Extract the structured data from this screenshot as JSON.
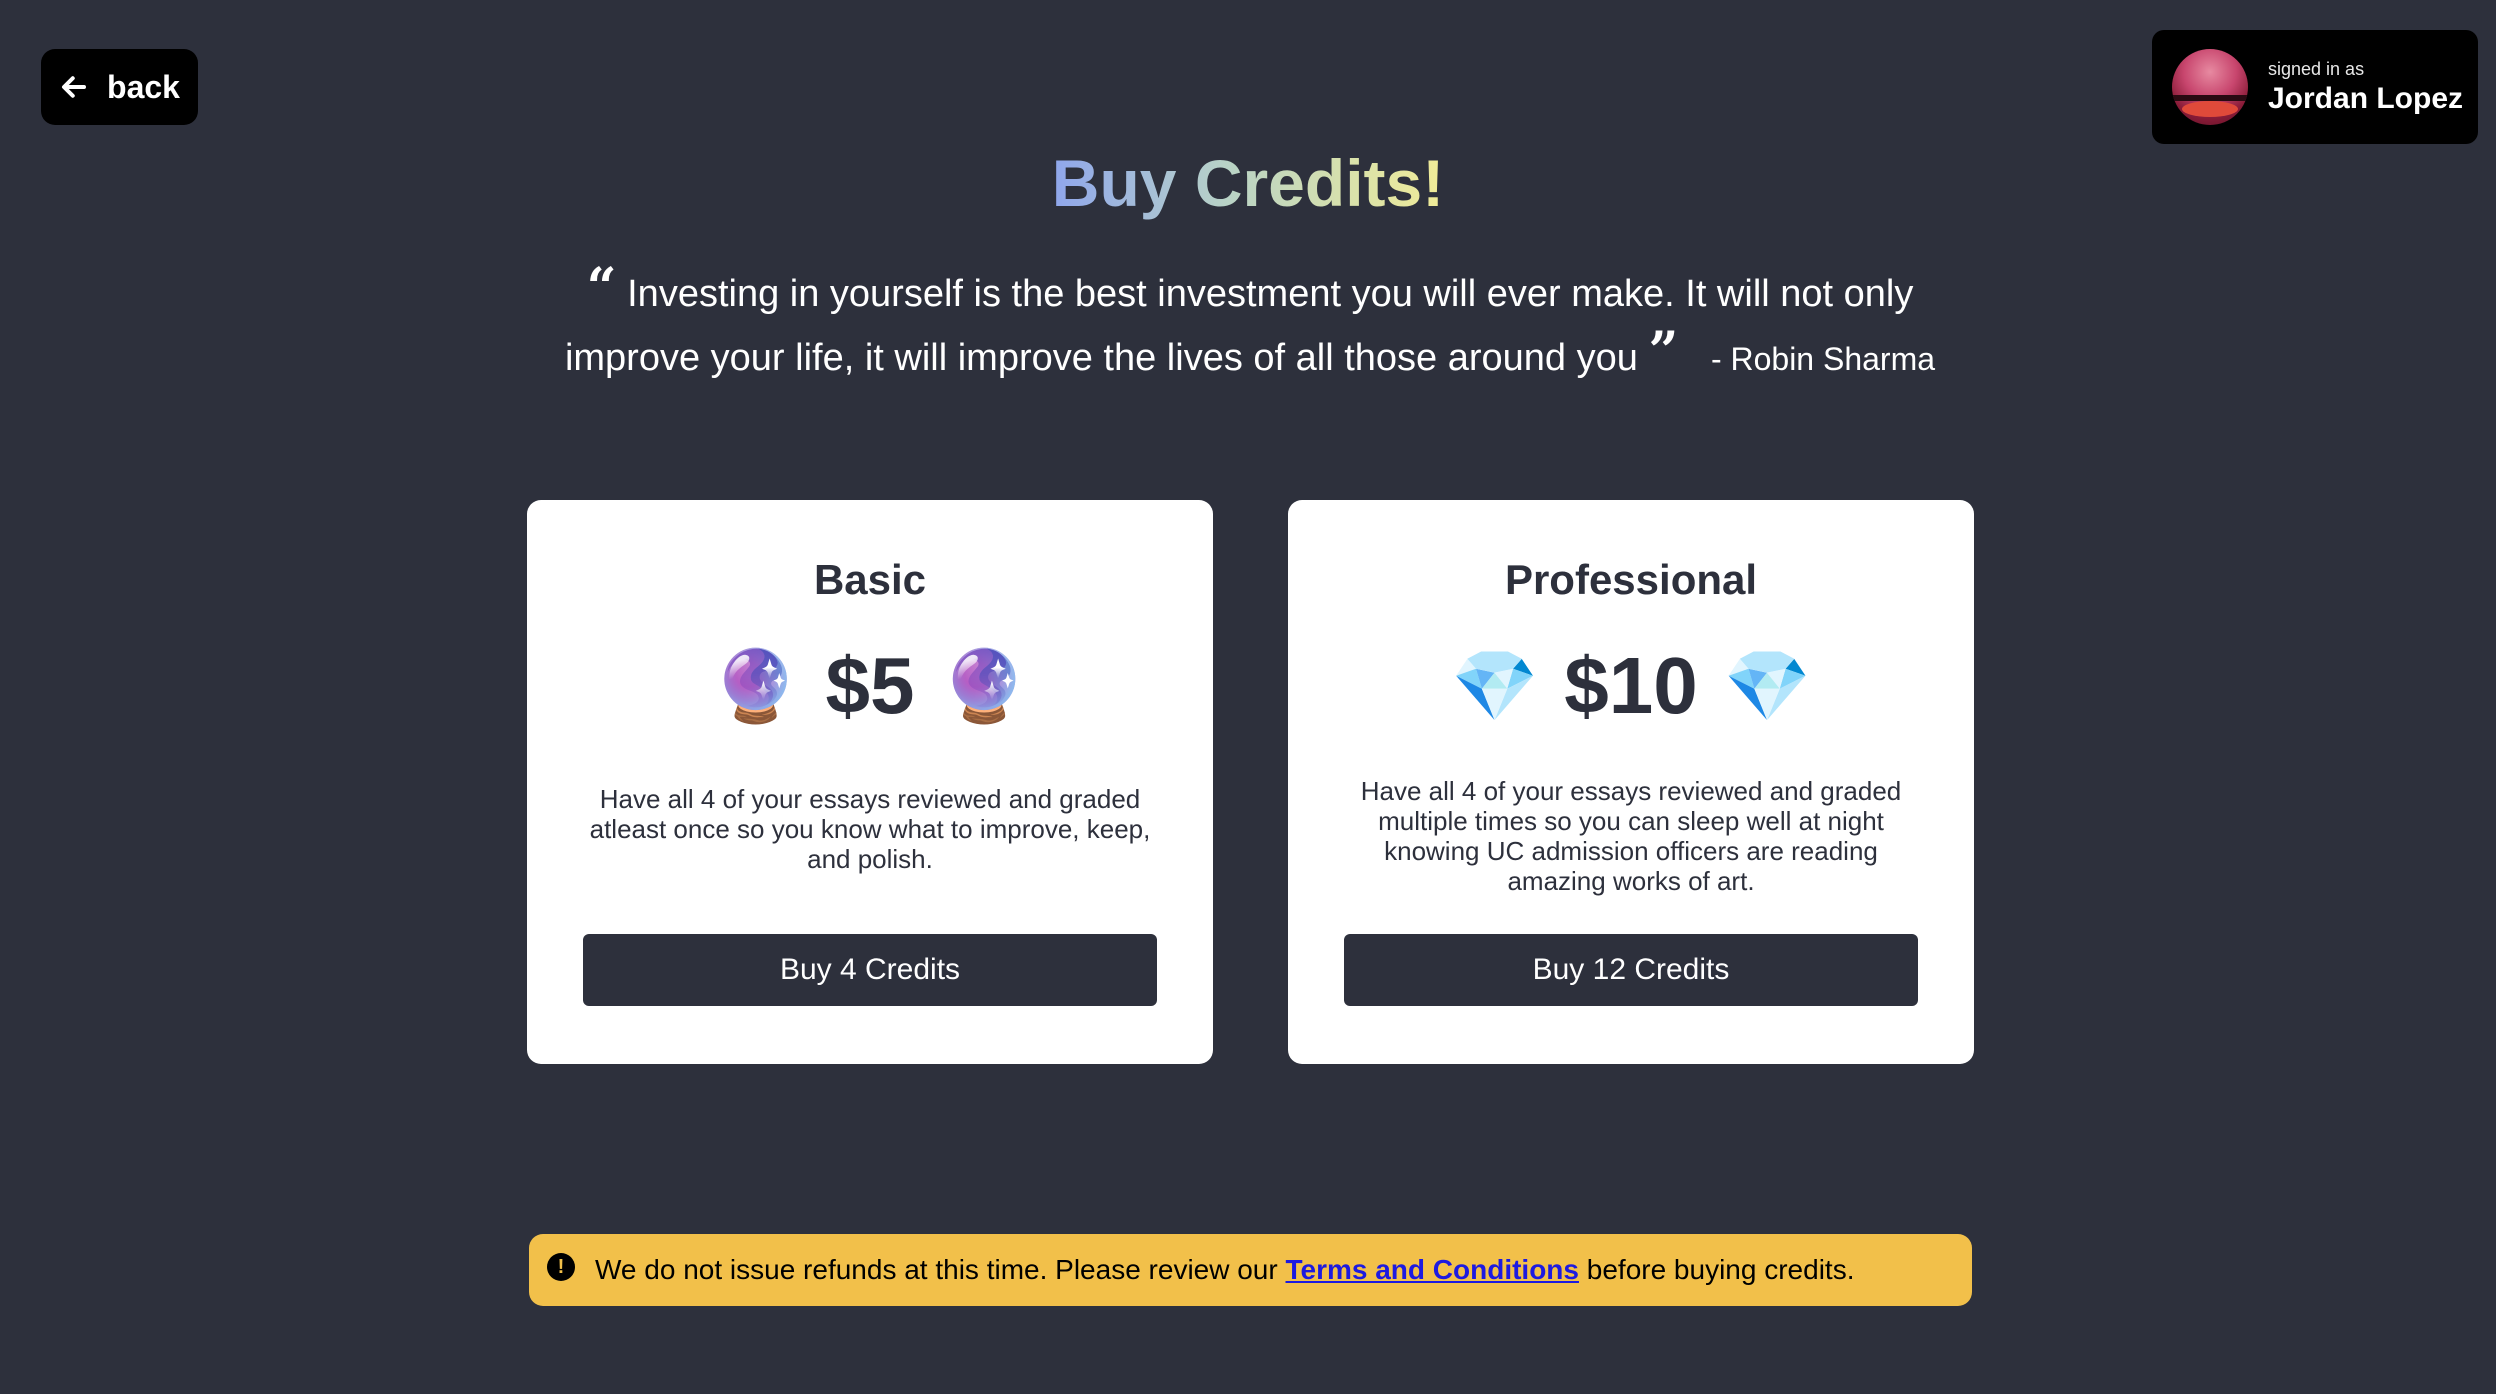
{
  "nav": {
    "back_label": "back"
  },
  "user": {
    "signed_in_label": "signed in as",
    "name": "Jordan Lopez"
  },
  "page": {
    "title": "Buy Credits!",
    "quote_open": "“",
    "quote_text": "Investing in yourself is the best investment you will ever make. It will not only improve your life, it will improve the lives of all those around you",
    "quote_close": "”",
    "quote_author": "- Robin Sharma"
  },
  "plans": [
    {
      "name": "Basic",
      "price": "$5",
      "emoji": "🔮",
      "description": "Have all 4 of your essays reviewed and graded atleast once so you know what to improve, keep, and polish.",
      "button_label": "Buy 4 Credits"
    },
    {
      "name": "Professional",
      "price": "$10",
      "emoji": "💎",
      "description": "Have all 4 of your essays reviewed and graded multiple times so you can sleep well at night knowing UC admission officers are reading amazing works of art.",
      "button_label": "Buy 12 Credits"
    }
  ],
  "notice": {
    "icon": "!",
    "text_before": "We do not issue refunds at this time. Please review our ",
    "link_text": "Terms and Conditions",
    "text_after": " before buying credits."
  },
  "colors": {
    "background": "#2d303c",
    "card": "#ffffff",
    "notice": "#f2c04a",
    "link": "#1d1ae0"
  }
}
